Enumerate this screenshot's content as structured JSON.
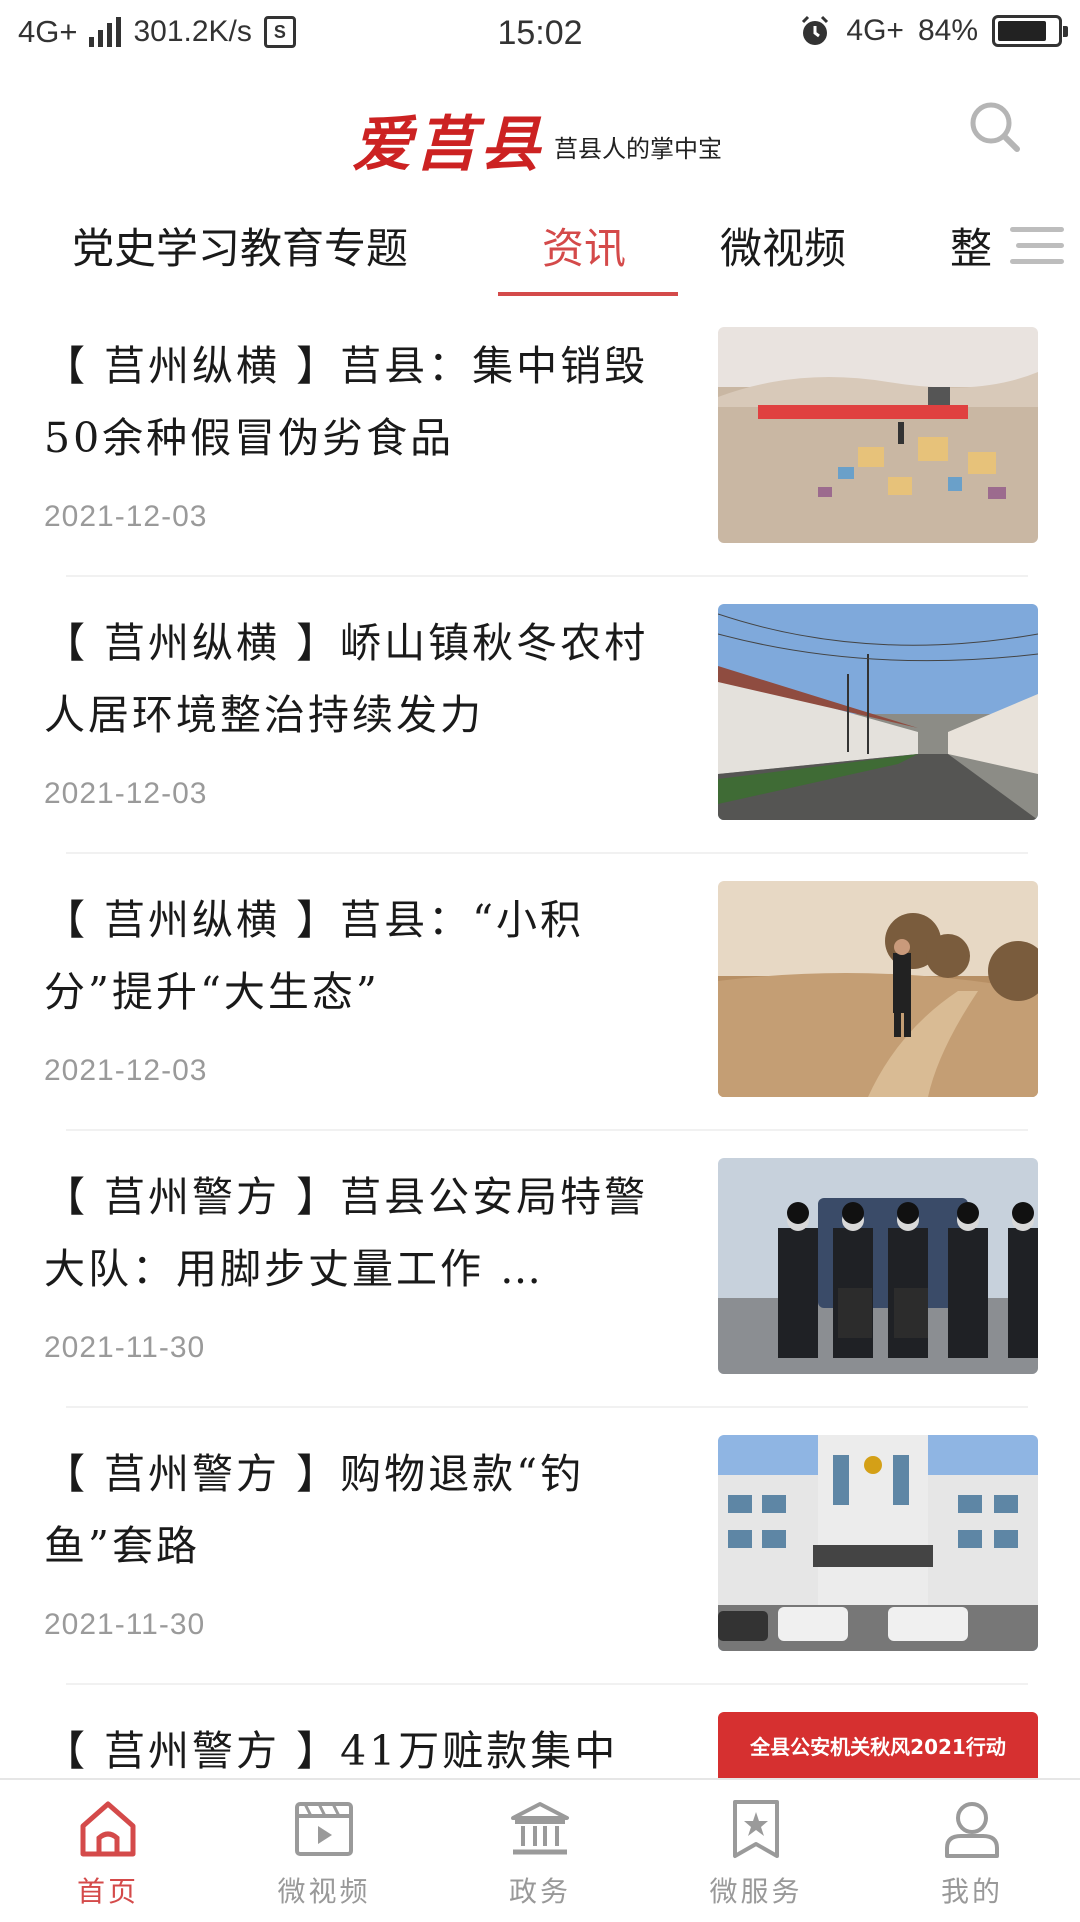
{
  "status_bar": {
    "network": "4G+",
    "speed": "301.2K/s",
    "s_badge": "S",
    "time": "15:02",
    "network_right": "4G+",
    "battery": "84%",
    "battery_level": 0.84
  },
  "header": {
    "logo": "爱莒县",
    "slogan": "莒县人的掌中宝"
  },
  "tabs": [
    {
      "label": "党史学习教育专题",
      "active": false
    },
    {
      "label": "资讯",
      "active": true
    },
    {
      "label": "微视频",
      "active": false
    },
    {
      "label": "整",
      "active": false
    }
  ],
  "feed": [
    {
      "title": "【 莒州纵横 】莒县：集中销毁50余种假冒伪劣食品",
      "date": "2021-12-03",
      "thumb": "销毁现场"
    },
    {
      "title": "【 莒州纵横 】峤山镇秋冬农村人居环境整治持续发力",
      "date": "2021-12-03",
      "thumb": "乡村道路"
    },
    {
      "title": "【 莒州纵横 】莒县：“小积分”提升“大生态”",
      "date": "2021-12-03",
      "thumb": "田野"
    },
    {
      "title": "【 莒州警方 】莒县公安局特警大队：用脚步丈量工作 …",
      "date": "2021-11-30",
      "thumb": "特警队员"
    },
    {
      "title": "【 莒州警方 】购物退款“钓鱼”套路",
      "date": "2021-11-30",
      "thumb": "公安大楼"
    },
    {
      "title": "【 莒州警方 】41万赃款集中",
      "date": "",
      "thumb": "全县公安机关秋风2021行动"
    }
  ],
  "bottom_nav": [
    {
      "label": "首页",
      "icon": "home-icon",
      "active": true
    },
    {
      "label": "微视频",
      "icon": "video-icon",
      "active": false
    },
    {
      "label": "政务",
      "icon": "government-icon",
      "active": false
    },
    {
      "label": "微服务",
      "icon": "service-icon",
      "active": false
    },
    {
      "label": "我的",
      "icon": "profile-icon",
      "active": false
    }
  ],
  "colors": {
    "accent": "#d44a4a",
    "logo_red": "#cc2222",
    "date_gray": "#9a9a9a"
  }
}
